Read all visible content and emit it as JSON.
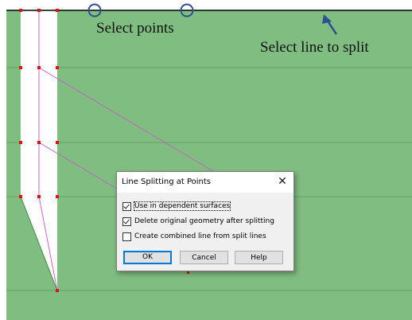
{
  "annotations": {
    "select_points": "Select points",
    "select_line": "Select line to split"
  },
  "colors": {
    "background": "#80bd80",
    "grid_line": "#5fa35f",
    "point": "#dd1111",
    "magenta_line": "#cc66cc",
    "annotation_blue": "#2f4f8f"
  },
  "dialog": {
    "title": "Line Splitting at Points",
    "close_glyph": "✕",
    "options": [
      {
        "label": "Use in dependent surfaces",
        "checked": true
      },
      {
        "label": "Delete original geometry after splitting",
        "checked": true
      },
      {
        "label": "Create combined line from split lines",
        "checked": false
      }
    ],
    "buttons": {
      "ok": "OK",
      "cancel": "Cancel",
      "help": "Help"
    }
  }
}
